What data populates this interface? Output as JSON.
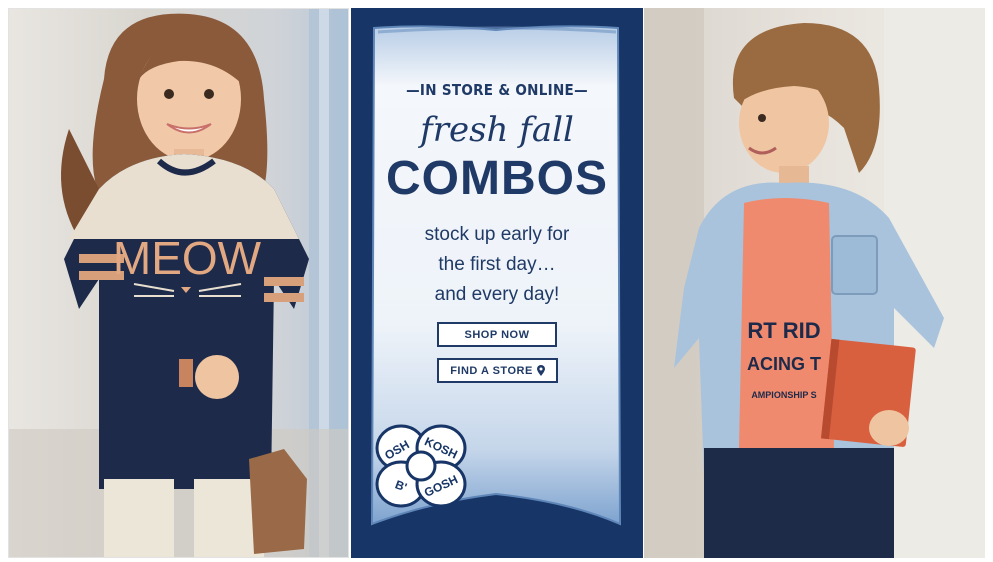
{
  "banner": {
    "eyebrow": "—IN STORE & ONLINE—",
    "script_title": "fresh fall",
    "big_title": "COMBOS",
    "tagline_lines": [
      "stock up early for",
      "the first day…",
      "and every day!"
    ],
    "shop_label": "SHOP NOW",
    "store_label": "FIND A STORE",
    "store_icon": "location-pin-icon"
  },
  "left_photo": {
    "shirt_text": "MEOW"
  },
  "right_photo": {
    "shirt_text_line1": "RT RID",
    "shirt_text_line2": "ACING T",
    "shirt_text_line3": "AMPIONSHIP S"
  },
  "logo": {
    "words": [
      "OSH",
      "KOSH",
      "B'",
      "GOSH"
    ]
  },
  "colors": {
    "navy": "#173566",
    "text_navy": "#1f3a66",
    "banner_white": "#f4f7fb",
    "banner_blue": "#7ea3cf",
    "shirt_coral": "#ef8a6e",
    "denim": "#a9c3dc"
  }
}
